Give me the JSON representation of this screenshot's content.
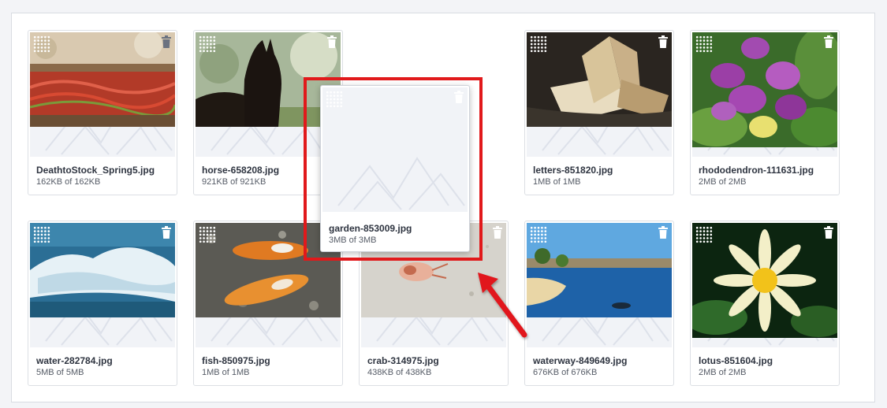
{
  "files": [
    {
      "name": "DeathtoStock_Spring5.jpg",
      "size": "162KB of 162KB"
    },
    {
      "name": "horse-658208.jpg",
      "size": "921KB of 921KB"
    },
    {
      "name": "letters-851820.jpg",
      "size": "1MB of 1MB"
    },
    {
      "name": "rhododendron-111631.jpg",
      "size": "2MB of 2MB"
    },
    {
      "name": "water-282784.jpg",
      "size": "5MB of 5MB"
    },
    {
      "name": "fish-850975.jpg",
      "size": "1MB of 1MB"
    },
    {
      "name": "crab-314975.jpg",
      "size": "438KB of 438KB"
    },
    {
      "name": "waterway-849649.jpg",
      "size": "676KB of 676KB"
    },
    {
      "name": "lotus-851604.jpg",
      "size": "2MB of 2MB"
    }
  ],
  "dragging": {
    "name": "garden-853009.jpg",
    "size": "3MB of 3MB"
  },
  "icons": {
    "drag": "drag-handle-icon",
    "delete": "trash-icon"
  },
  "colors": {
    "highlight": "#e1191b"
  }
}
